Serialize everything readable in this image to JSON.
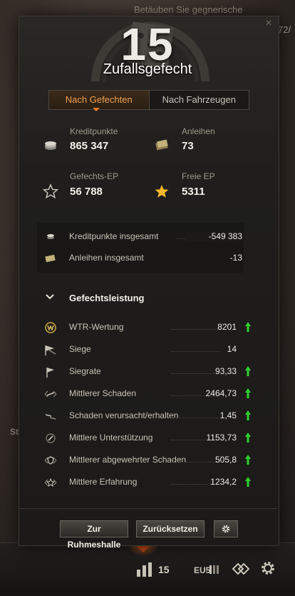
{
  "background": {
    "top_text": "Betäuben Sie gegnerische",
    "right_number": "72/",
    "left_label": "St"
  },
  "header": {
    "battle_count": "15",
    "battle_type": "Zufallsgefecht"
  },
  "tabs": [
    {
      "label": "Nach Gefechten",
      "active": true
    },
    {
      "label": "Nach Fahrzeugen",
      "active": false
    }
  ],
  "earnings": {
    "credits": {
      "label": "Kreditpunkte",
      "value": "865 347",
      "icon": "coins-icon"
    },
    "bonds": {
      "label": "Anleihen",
      "value": "73",
      "icon": "bonds-icon"
    },
    "battle_xp": {
      "label": "Gefechts-EP",
      "value": "56 788",
      "icon": "star-outline-icon"
    },
    "free_xp": {
      "label": "Freie EP",
      "value": "5311",
      "icon": "star-filled-icon"
    }
  },
  "totals": [
    {
      "label": "Kreditpunkte insgesamt",
      "value": "-549 383",
      "icon": "coins-icon"
    },
    {
      "label": "Anleihen insgesamt",
      "value": "-13",
      "icon": "bonds-icon"
    }
  ],
  "performance": {
    "title": "Gefechtsleistung",
    "rows": [
      {
        "label": "WTR-Wertung",
        "value": "8201",
        "trend_up": true,
        "icon": "wtr-badge-icon"
      },
      {
        "label": "Siege",
        "value": "14",
        "trend_up": false,
        "icon": "victory-flags-icon"
      },
      {
        "label": "Siegrate",
        "value": "93,33",
        "trend_up": true,
        "icon": "flag-icon"
      },
      {
        "label": "Mittlerer Schaden",
        "value": "2464,73",
        "trend_up": true,
        "icon": "damage-icon"
      },
      {
        "label": "Schaden verursacht/erhalten",
        "value": "1,45",
        "trend_up": true,
        "icon": "damage-ratio-icon"
      },
      {
        "label": "Mittlere Unterstützung",
        "value": "1153,73",
        "trend_up": true,
        "icon": "assist-icon"
      },
      {
        "label": "Mittlerer abgewehrter Schaden",
        "value": "505,8",
        "trend_up": true,
        "icon": "blocked-damage-icon"
      },
      {
        "label": "Mittlere Erfahrung",
        "value": "1234,2",
        "trend_up": true,
        "icon": "experience-icon"
      }
    ]
  },
  "footer": {
    "hall_of_fame": "Zur Ruhmeshalle",
    "reset": "Zurücksetzen"
  },
  "bottom_bar": {
    "battles": "15",
    "server": "EU5"
  },
  "colors": {
    "accent": "#e07a2a",
    "trend_up": "#2fd22f",
    "panel_bg": "#1f1e1c"
  }
}
